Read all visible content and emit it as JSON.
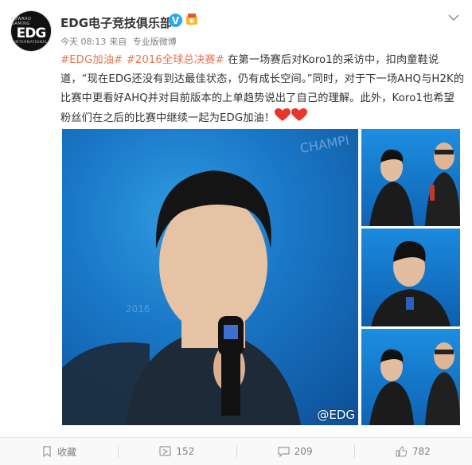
{
  "post": {
    "author": "EDG电子竞技俱乐部",
    "verified_badge": "V",
    "avatar": {
      "arc_text": "EDWARD GAMING",
      "logo": "EDG",
      "sub_text": "INTERNATIONAL"
    },
    "time": "今天 08:13",
    "from_label": "来自",
    "source": "专业版微博",
    "text": {
      "hashtag1": "#EDG加油#",
      "hashtag2": "#2016全球总决赛#",
      "body": " 在第一场赛后对Koro1的采访中，扣肉童鞋说道，“现在EDG还没有到达最佳状态，仍有成长空间。”同时，对于下一场AHQ与H2K的比赛中更看好AHQ并对目前版本的上单趋势说出了自己的理解。此外，Koro1也希望粉丝们在之后的比赛中继续一起为EDG加油！"
    },
    "image_watermark": "@EDG",
    "icons": {
      "verified": "verified-badge-icon",
      "medal": "medal-icon",
      "more": "chevron-down-icon",
      "hearts": "heart-icon"
    }
  },
  "footer": {
    "favorite_label": "收藏",
    "repost_count": "152",
    "comment_count": "209",
    "like_count": "782"
  },
  "colors": {
    "hashtag": "#eb7350",
    "verified": "#2aa7f5",
    "heart": "#e8362b"
  }
}
